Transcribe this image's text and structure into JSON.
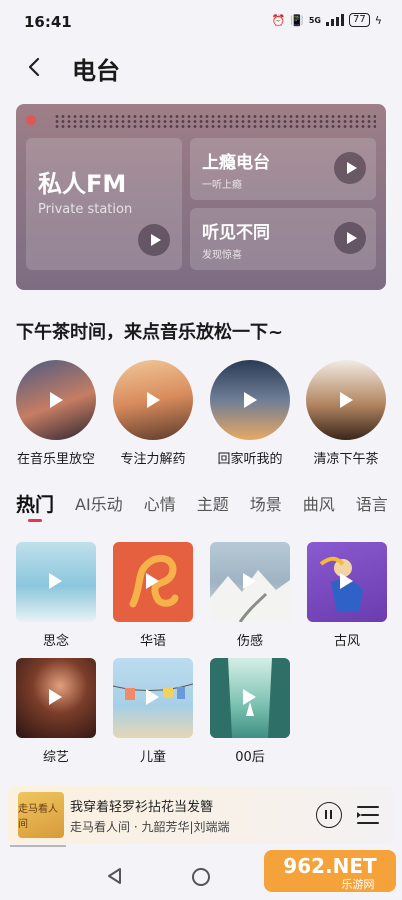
{
  "status": {
    "time": "16:41",
    "network": "5G",
    "battery": "77"
  },
  "header": {
    "title": "电台"
  },
  "radio": {
    "fm_title": "私人FM",
    "fm_subtitle": "Private station",
    "box1_title": "上瘾电台",
    "box1_sub": "一听上瘾",
    "box2_title": "听见不同",
    "box2_sub": "发现惊喜"
  },
  "section": {
    "title": "下午茶时间，来点音乐放松一下~"
  },
  "playlists": [
    {
      "label": "在音乐里放空"
    },
    {
      "label": "专注力解药"
    },
    {
      "label": "回家听我的"
    },
    {
      "label": "清凉下午茶"
    }
  ],
  "tabs": [
    "热门",
    "AI乐动",
    "心情",
    "主题",
    "场景",
    "曲风",
    "语言"
  ],
  "categories": [
    {
      "label": "思念"
    },
    {
      "label": "华语"
    },
    {
      "label": "伤感"
    },
    {
      "label": "古风"
    },
    {
      "label": "综艺"
    },
    {
      "label": "儿童"
    },
    {
      "label": "00后"
    }
  ],
  "player": {
    "song": "我穿着轻罗衫拈花当发簪",
    "artist": "走马看人间 · 九韶芳华|刘端端",
    "cover_text": "走马看人间"
  },
  "watermark": {
    "text": "962.NET",
    "sub": "乐游网"
  },
  "colors": {
    "accent": "#e6354f",
    "card": "#8d7585"
  }
}
